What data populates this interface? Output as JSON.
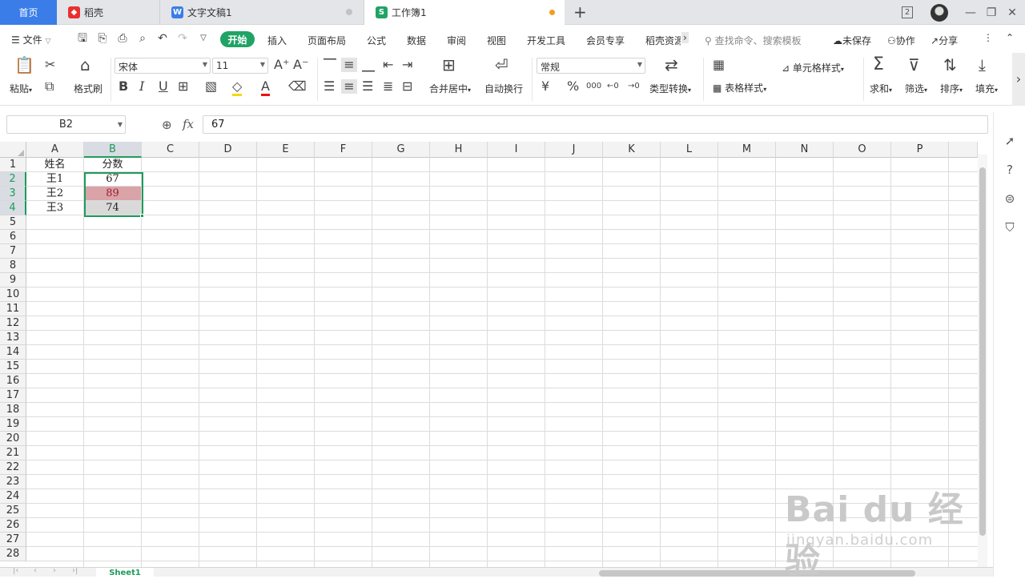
{
  "tabs": {
    "home": "首页",
    "daoke": "稻壳",
    "doc": "文字文稿1",
    "workbook": "工作簿1",
    "window_count": "2"
  },
  "menu": {
    "file": "文件",
    "items": [
      "开始",
      "插入",
      "页面布局",
      "公式",
      "数据",
      "审阅",
      "视图",
      "开发工具",
      "会员专享",
      "稻壳资源"
    ],
    "search_placeholder": "查找命令、搜索模板",
    "unsaved": "未保存",
    "collab": "协作",
    "share": "分享"
  },
  "ribbon": {
    "paste": "粘贴",
    "format_painter": "格式刷",
    "font": "宋体",
    "font_size": "11",
    "merge_center": "合并居中",
    "wrap_text": "自动换行",
    "number_format": "常规",
    "type_convert": "类型转换",
    "cell_style": "单元格样式",
    "table_style": "表格样式",
    "sum": "求和",
    "filter": "筛选",
    "sort": "排序",
    "fill": "填充"
  },
  "formula_bar": {
    "name_box": "B2",
    "fx": "fx",
    "value": "67"
  },
  "sheet": {
    "columns": [
      "A",
      "B",
      "C",
      "D",
      "E",
      "F",
      "G",
      "H",
      "I",
      "J",
      "K",
      "L",
      "M",
      "N",
      "O",
      "P"
    ],
    "rows": [
      "1",
      "2",
      "3",
      "4",
      "5",
      "6",
      "7",
      "8",
      "9",
      "10",
      "11",
      "12",
      "13",
      "14",
      "15",
      "16",
      "17",
      "18",
      "19",
      "20",
      "21",
      "22",
      "23",
      "24",
      "25",
      "26",
      "27",
      "28"
    ],
    "cells": [
      {
        "col": 0,
        "row": 0,
        "text": "姓名"
      },
      {
        "col": 1,
        "row": 0,
        "text": "分数"
      },
      {
        "col": 0,
        "row": 1,
        "text": "王1"
      },
      {
        "col": 1,
        "row": 1,
        "text": "67"
      },
      {
        "col": 0,
        "row": 2,
        "text": "王2"
      },
      {
        "col": 1,
        "row": 2,
        "text": "89",
        "bg": "#d9a3a8",
        "color": "#9c1c26"
      },
      {
        "col": 0,
        "row": 3,
        "text": "王3"
      },
      {
        "col": 1,
        "row": 3,
        "text": "74",
        "bg": "#d9d9d9"
      }
    ],
    "sheet_name": "Sheet1"
  },
  "watermark": {
    "line1": "Bai du 经验",
    "line2": "jingyan.baidu.com"
  },
  "colors": {
    "accent": "#21a366",
    "selection": "#1e9b5c",
    "home_tab": "#3a7de8"
  }
}
